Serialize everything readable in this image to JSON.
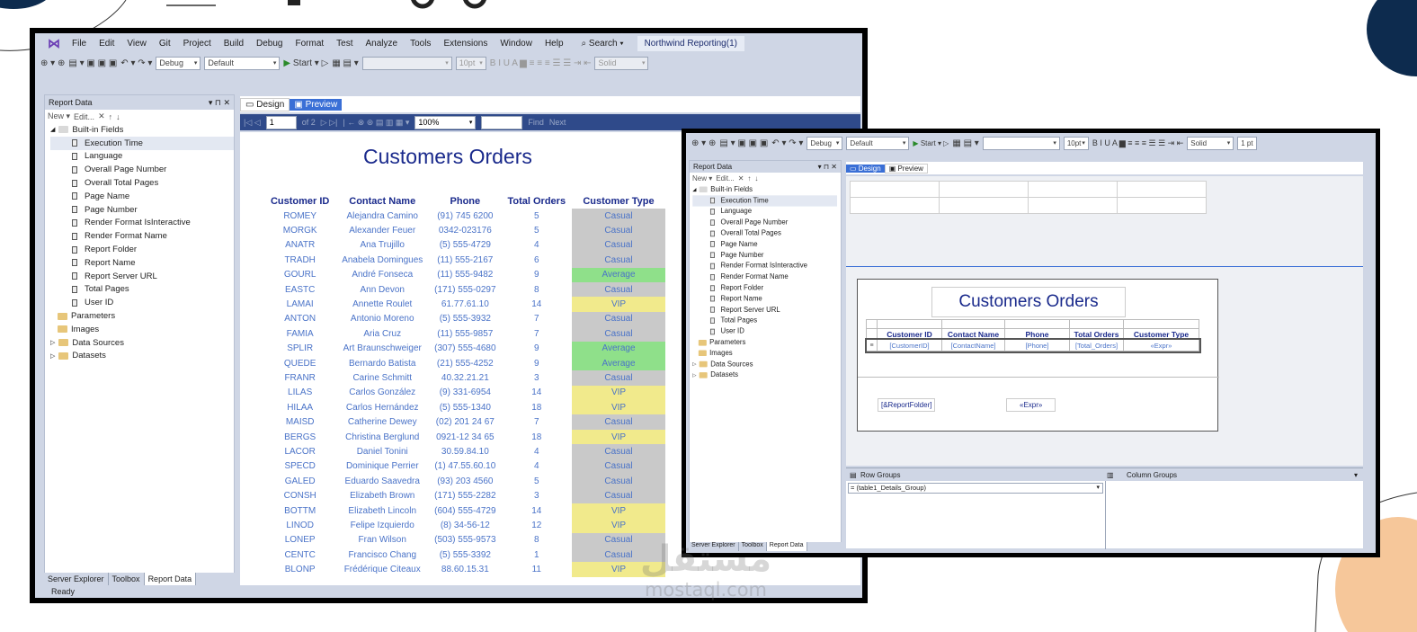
{
  "colors": {
    "casual": "#c9c9c9",
    "average": "#8fe08a",
    "vip": "#f1ea8c",
    "accent": "#1a2a8c",
    "navy": "#0d2b4e",
    "peach": "#f6c79a"
  },
  "menu": [
    "File",
    "Edit",
    "View",
    "Git",
    "Project",
    "Build",
    "Debug",
    "Format",
    "Test",
    "Analyze",
    "Tools",
    "Extensions",
    "Window",
    "Help"
  ],
  "search_label": "Search",
  "solution_title": "Northwind Reporting(1)",
  "toolbar": {
    "config": "Debug",
    "platform": "Default",
    "start": "Start",
    "fontsize": "10pt",
    "linestyle": "Solid",
    "linewidth": "1 pt"
  },
  "report_data": {
    "title": "Report Data",
    "new_label": "New",
    "edit_label": "Edit...",
    "builtin": "Built-in Fields",
    "fields": [
      "Execution Time",
      "Language",
      "Overall Page Number",
      "Overall Total Pages",
      "Page Name",
      "Page Number",
      "Render Format IsInteractive",
      "Render Format Name",
      "Report Folder",
      "Report Name",
      "Report Server URL",
      "Total Pages",
      "User ID"
    ],
    "folders": [
      "Parameters",
      "Images",
      "Data Sources",
      "Datasets"
    ]
  },
  "bottom_tabs": [
    "Server Explorer",
    "Toolbox",
    "Report Data"
  ],
  "tabs": {
    "design": "Design",
    "preview": "Preview"
  },
  "preview_toolbar": {
    "page": "1",
    "of": "of 2",
    "zoom": "100%",
    "find": "Find",
    "next": "Next"
  },
  "report": {
    "title": "Customers Orders",
    "headers": [
      "Customer ID",
      "Contact Name",
      "Phone",
      "Total Orders",
      "Customer Type"
    ],
    "rows": [
      [
        "ROMEY",
        "Alejandra Camino",
        "(91) 745 6200",
        "5",
        "Casual"
      ],
      [
        "MORGK",
        "Alexander Feuer",
        "0342-023176",
        "5",
        "Casual"
      ],
      [
        "ANATR",
        "Ana Trujillo",
        "(5) 555-4729",
        "4",
        "Casual"
      ],
      [
        "TRADH",
        "Anabela Domingues",
        "(11) 555-2167",
        "6",
        "Casual"
      ],
      [
        "GOURL",
        "André Fonseca",
        "(11) 555-9482",
        "9",
        "Average"
      ],
      [
        "EASTC",
        "Ann Devon",
        "(171) 555-0297",
        "8",
        "Casual"
      ],
      [
        "LAMAI",
        "Annette Roulet",
        "61.77.61.10",
        "14",
        "VIP"
      ],
      [
        "ANTON",
        "Antonio Moreno",
        "(5) 555-3932",
        "7",
        "Casual"
      ],
      [
        "FAMIA",
        "Aria Cruz",
        "(11) 555-9857",
        "7",
        "Casual"
      ],
      [
        "SPLIR",
        "Art Braunschweiger",
        "(307) 555-4680",
        "9",
        "Average"
      ],
      [
        "QUEDE",
        "Bernardo Batista",
        "(21) 555-4252",
        "9",
        "Average"
      ],
      [
        "FRANR",
        "Carine Schmitt",
        "40.32.21.21",
        "3",
        "Casual"
      ],
      [
        "LILAS",
        "Carlos González",
        "(9) 331-6954",
        "14",
        "VIP"
      ],
      [
        "HILAA",
        "Carlos Hernández",
        "(5) 555-1340",
        "18",
        "VIP"
      ],
      [
        "MAISD",
        "Catherine Dewey",
        "(02) 201 24 67",
        "7",
        "Casual"
      ],
      [
        "BERGS",
        "Christina Berglund",
        "0921-12 34 65",
        "18",
        "VIP"
      ],
      [
        "LACOR",
        "Daniel Tonini",
        "30.59.84.10",
        "4",
        "Casual"
      ],
      [
        "SPECD",
        "Dominique Perrier",
        "(1) 47.55.60.10",
        "4",
        "Casual"
      ],
      [
        "GALED",
        "Eduardo Saavedra",
        "(93) 203 4560",
        "5",
        "Casual"
      ],
      [
        "CONSH",
        "Elizabeth Brown",
        "(171) 555-2282",
        "3",
        "Casual"
      ],
      [
        "BOTTM",
        "Elizabeth Lincoln",
        "(604) 555-4729",
        "14",
        "VIP"
      ],
      [
        "LINOD",
        "Felipe Izquierdo",
        "(8) 34-56-12",
        "12",
        "VIP"
      ],
      [
        "LONEP",
        "Fran Wilson",
        "(503) 555-9573",
        "8",
        "Casual"
      ],
      [
        "CENTC",
        "Francisco Chang",
        "(5) 555-3392",
        "1",
        "Casual"
      ],
      [
        "BLONP",
        "Frédérique Citeaux",
        "88.60.15.31",
        "11",
        "VIP"
      ]
    ]
  },
  "design": {
    "title": "Customers Orders",
    "headers": [
      "Customer ID",
      "Contact Name",
      "Phone",
      "Total Orders",
      "Customer Type"
    ],
    "cells": [
      "[CustomerID]",
      "[ContactName]",
      "[Phone]",
      "[Total_Orders]",
      "«Expr»"
    ],
    "footer_left": "[&ReportFolder]",
    "footer_right": "«Expr»",
    "row_groups": "Row Groups",
    "column_groups": "Column Groups",
    "group_item": "= (table1_Details_Group)"
  },
  "status": "Ready",
  "watermark": {
    "ar": "مستقل",
    "latin": "mostaql.com"
  }
}
